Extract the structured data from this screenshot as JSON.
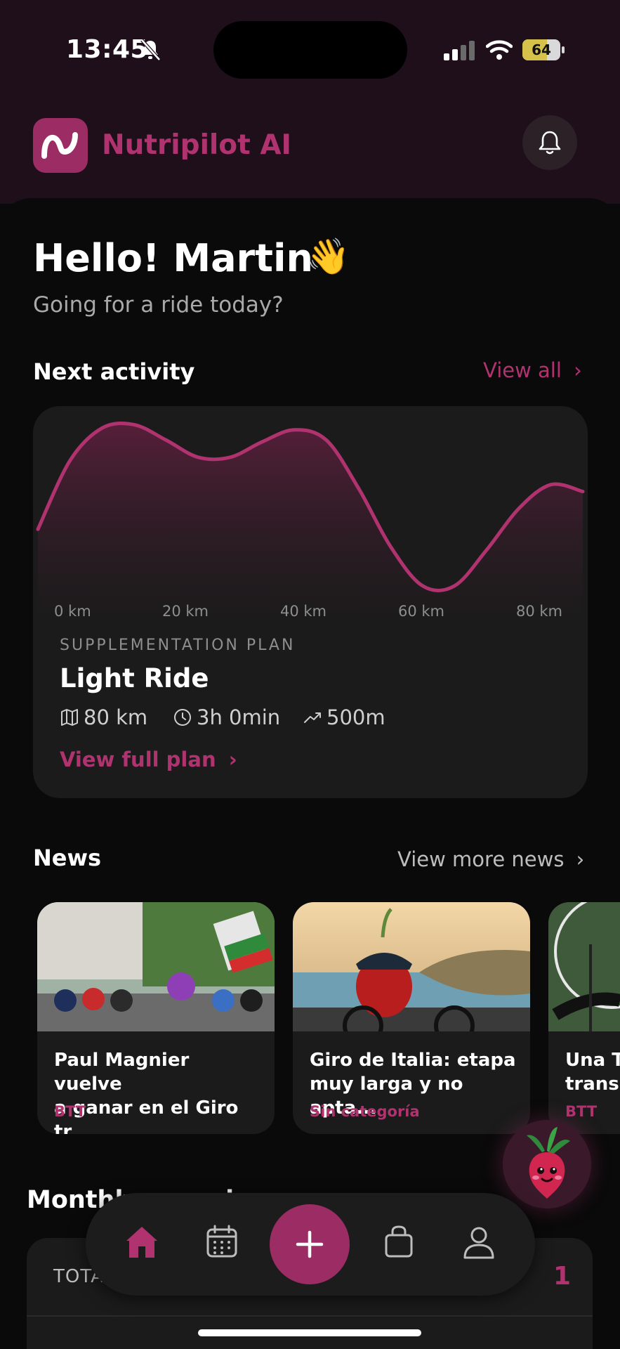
{
  "status": {
    "time": "13:45",
    "battery": "64",
    "battery_level": 0.64
  },
  "header": {
    "brand": "Nutripilot AI"
  },
  "greeting": {
    "title": "Hello! Martin",
    "emoji": "👋",
    "subtitle": "Going for a ride today?"
  },
  "next_activity": {
    "section_title": "Next activity",
    "view_all": "View all",
    "plan_label": "SUPPLEMENTATION PLAN",
    "plan_title": "Light Ride",
    "distance": "80 km",
    "duration": "3h 0min",
    "elevation": "500m",
    "view_full_plan": "View full plan"
  },
  "chart_data": {
    "type": "area",
    "x_ticks": [
      "0 km",
      "20 km",
      "40 km",
      "60 km",
      "80 km"
    ],
    "x": [
      0,
      5,
      10,
      15,
      20,
      25,
      30,
      35,
      40,
      45,
      50,
      55,
      60,
      65,
      70,
      75,
      80,
      85
    ],
    "values": [
      38,
      78,
      97,
      99,
      90,
      80,
      80,
      89,
      96,
      90,
      62,
      28,
      5,
      5,
      26,
      50,
      64,
      60
    ],
    "xlim": [
      0,
      85
    ],
    "ylim": [
      0,
      100
    ],
    "color": "#b0336f"
  },
  "news": {
    "section_title": "News",
    "view_more": "View more news",
    "items": [
      {
        "title_line1": "Paul Magnier vuelve",
        "title_line2": "a ganar en el Giro tr...",
        "category": "BTT"
      },
      {
        "title_line1": "Giro de Italia: etapa",
        "title_line2": "muy larga y no apta...",
        "category": "Sin categoría"
      },
      {
        "title_line1": "Una T",
        "title_line2": "transm",
        "category": "BTT"
      }
    ]
  },
  "monthly": {
    "title": "Monthly overview",
    "total_label": "TOTAL",
    "total_value": "1"
  },
  "colors": {
    "accent": "#b0336f",
    "accent_dark": "#9b2c64",
    "header_bg": "#1e0f1a",
    "card_bg": "#1b1b1b"
  }
}
